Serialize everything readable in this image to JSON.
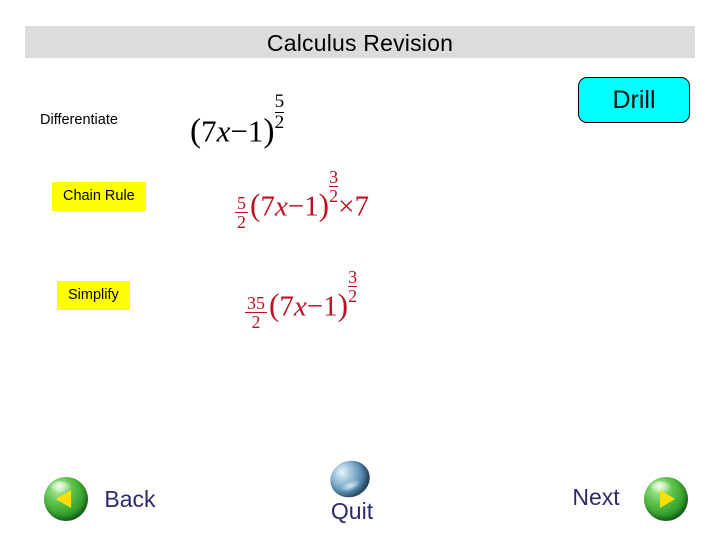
{
  "slide": {
    "title": "Calculus Revision",
    "title_bar_color": "#dcdcdc"
  },
  "drill_button": {
    "label": "Drill",
    "fill_color": "#00ffff",
    "border_color": "#000000"
  },
  "steps": [
    {
      "label": "Differentiate",
      "highlighted": false,
      "label_color": "#000000",
      "expression_text": "(7x - 1)^(5/2)",
      "expression_color": "#000000"
    },
    {
      "label": "Chain Rule",
      "highlighted": true,
      "highlight_color": "#ffff00",
      "label_color": "#000000",
      "expression_text": "5/2 (7x - 1)^(3/2) x 7",
      "expression_color": "#BB1122"
    },
    {
      "label": "Simplify",
      "highlighted": true,
      "highlight_color": "#ffff00",
      "label_color": "#000000",
      "expression_text": "35/2 (7x - 1)^(3/2)",
      "expression_color": "#BB1122"
    }
  ],
  "math": {
    "expr1": {
      "base_open": "(",
      "coefficient": "7",
      "variable": "x",
      "minus": "−",
      "constant": "1",
      "base_close": ")",
      "exp_num": "5",
      "exp_den": "2"
    },
    "expr2": {
      "frac_num": "5",
      "frac_den": "2",
      "base_open": "(",
      "coefficient": "7",
      "variable": "x",
      "minus": "−",
      "constant": "1",
      "base_close": ")",
      "exp_num": "3",
      "exp_den": "2",
      "times": "×",
      "multiplier": "7"
    },
    "expr3": {
      "frac_num": "35",
      "frac_den": "2",
      "base_open": "(",
      "coefficient": "7",
      "variable": "x",
      "minus": "−",
      "constant": "1",
      "base_close": ")",
      "exp_num": "3",
      "exp_den": "2"
    }
  },
  "navigation": {
    "back_label": "Back",
    "quit_label": "Quit",
    "next_label": "Next",
    "label_color": "#2B2B6B",
    "back_icon": "green-orb-left-arrow",
    "quit_icon": "blue-orb",
    "next_icon": "green-orb-right-arrow"
  }
}
